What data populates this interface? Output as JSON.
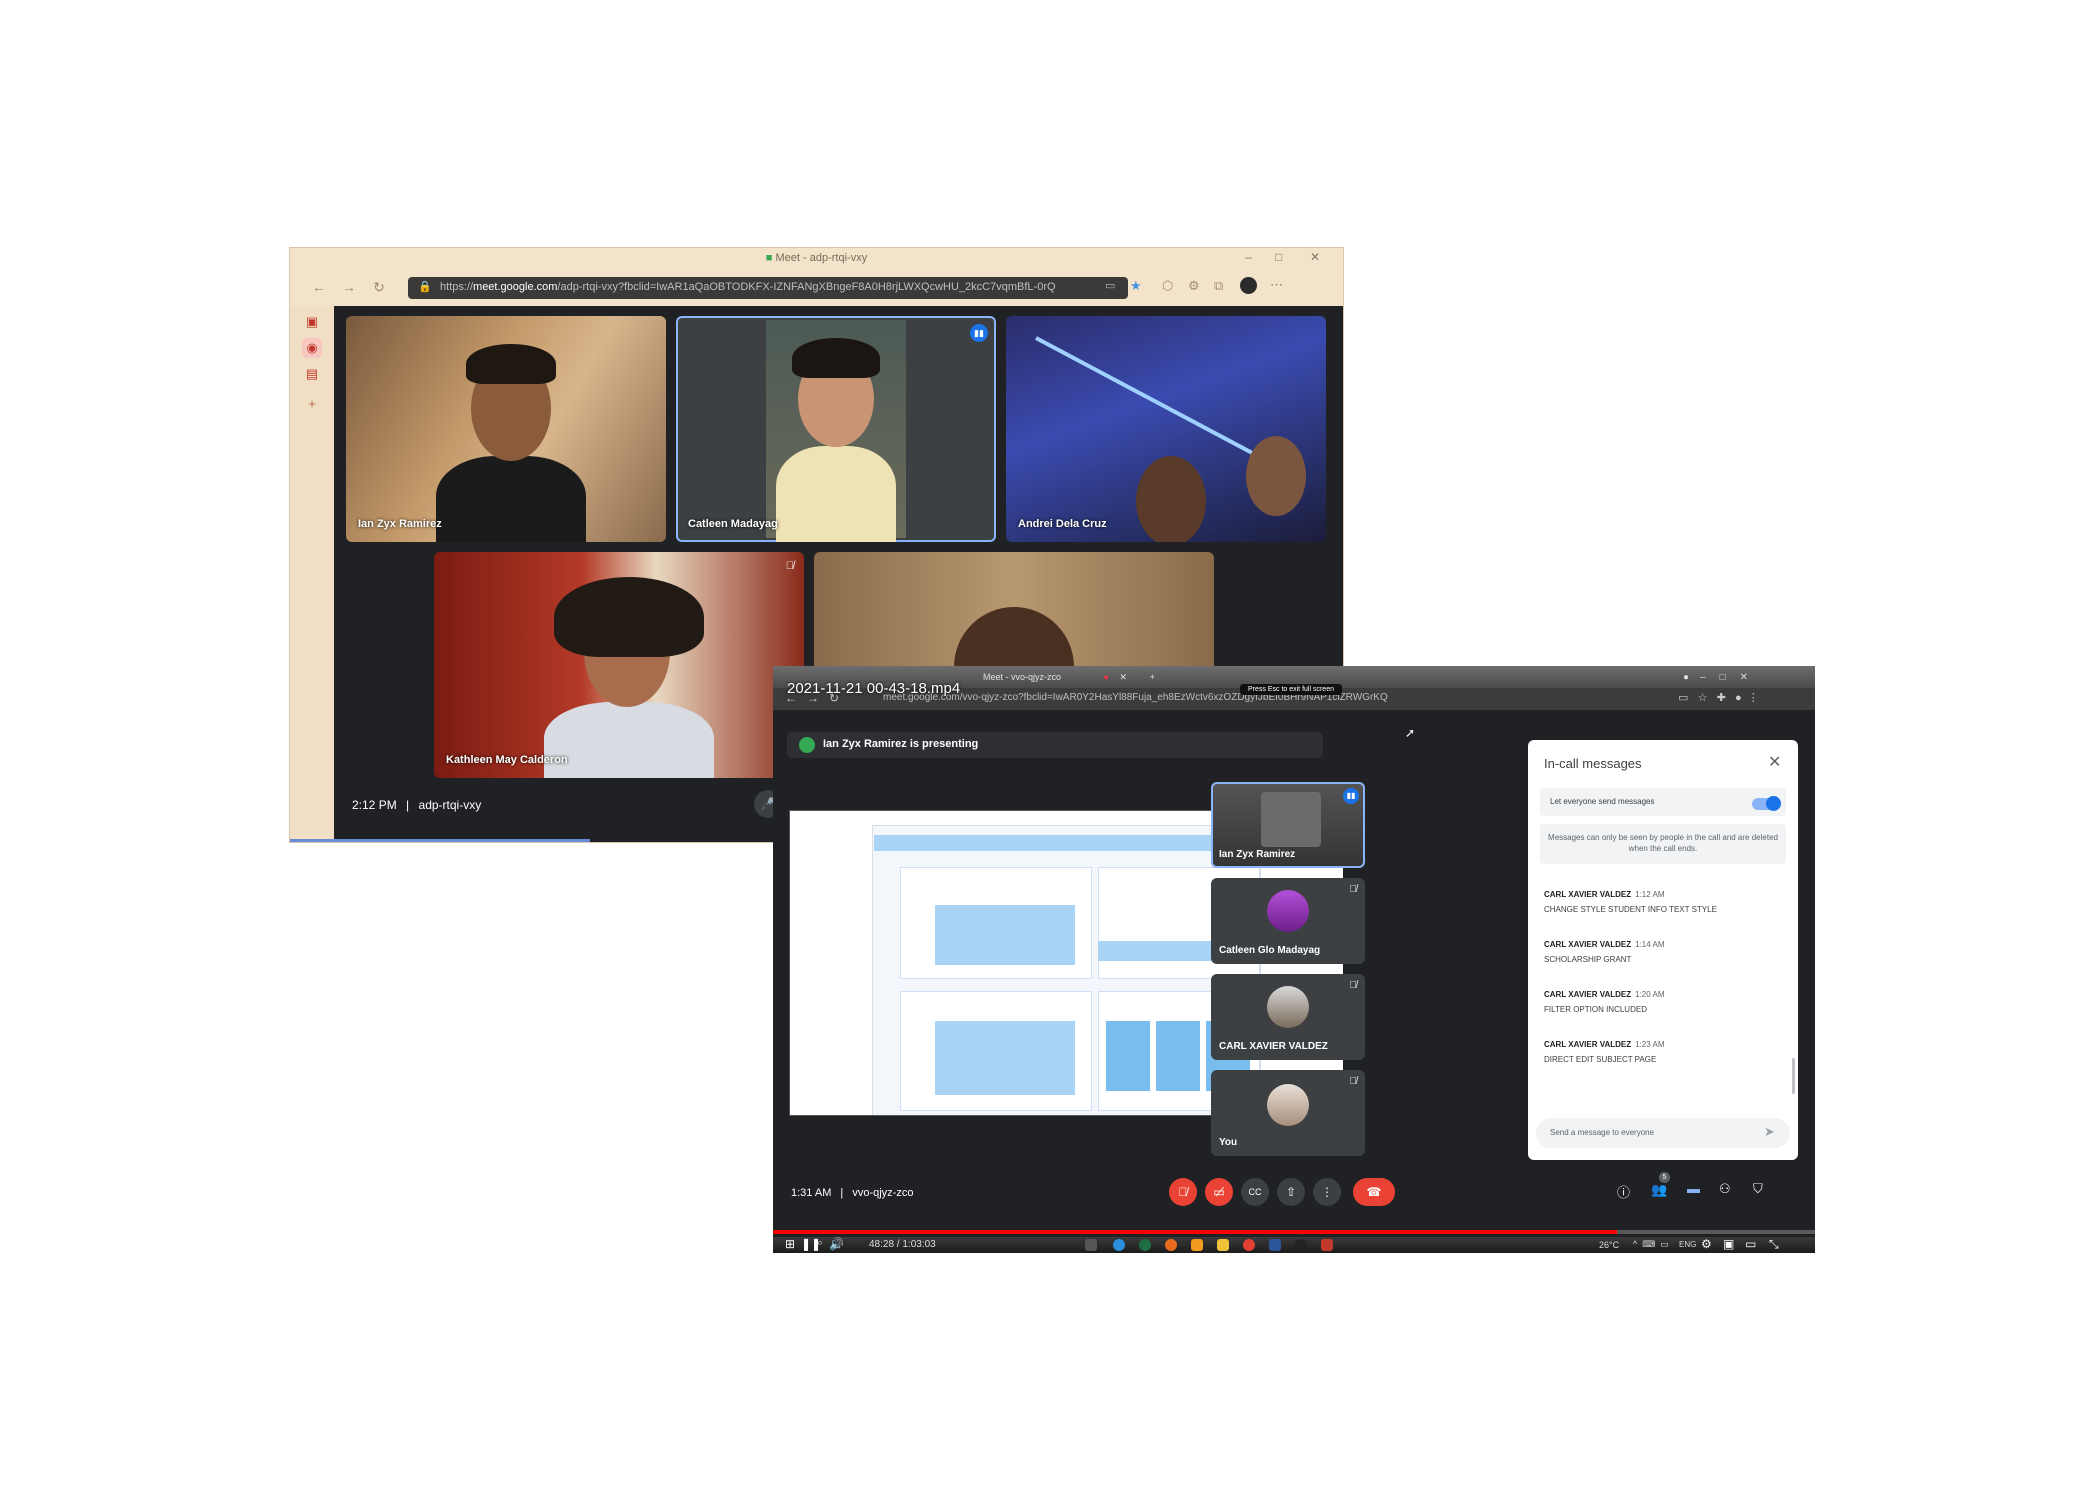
{
  "window1": {
    "tab_title": "Meet - adp-rtqi-vxy",
    "url_domain": "meet.google.com",
    "url_prefix": "https://",
    "url_path": "/adp-rtqi-vxy?fbclid=IwAR1aQaOBTODKFX-IZNFANgXBngeF8A0H8rjLWXQcwHU_2kcC7vqmBfL-0rQ",
    "participants": [
      {
        "name": "Ian Zyx Ramirez"
      },
      {
        "name": "Catleen Madayag"
      },
      {
        "name": "Andrei Dela Cruz"
      },
      {
        "name": "Kathleen May Calderon"
      },
      {
        "name": ""
      }
    ],
    "time": "2:12 PM",
    "separator": "|",
    "meeting_code": "adp-rtqi-vxy"
  },
  "window2": {
    "video_title": "2021-11-21 00-43-18.mp4",
    "tab_title": "Meet - vvo-qjyz-zco",
    "url": "meet.google.com/vvo-qjyz-zco?fbclid=IwAR0Y2HasYl88Fuja_eh8EzWctv6xzOZDgyfJbEI0BHr9NAP1clZRWGrKQ",
    "fullscreen_hint": "Press Esc to exit full screen",
    "presenting_banner": "Ian Zyx Ramirez is presenting",
    "side_tiles": [
      {
        "name": "Ian Zyx Ramirez"
      },
      {
        "name": "Catleen Glo Madayag"
      },
      {
        "name": "CARL XAVIER VALDEZ"
      },
      {
        "name": "You"
      }
    ],
    "chat": {
      "title": "In-call messages",
      "toggle_label": "Let everyone send messages",
      "note": "Messages can only be seen by people in the call and are deleted when the call ends.",
      "messages": [
        {
          "sender": "CARL XAVIER VALDEZ",
          "time": "1:12 AM",
          "text": "CHANGE STYLE STUDENT INFO TEXT STYLE"
        },
        {
          "sender": "CARL XAVIER VALDEZ",
          "time": "1:14 AM",
          "text": "SCHOLARSHIP GRANT"
        },
        {
          "sender": "CARL XAVIER VALDEZ",
          "time": "1:20 AM",
          "text": "FILTER OPTION INCLUDED"
        },
        {
          "sender": "CARL XAVIER VALDEZ",
          "time": "1:23 AM",
          "text": "DIRECT EDIT SUBJECT PAGE"
        }
      ],
      "input_placeholder": "Send a message to everyone"
    },
    "time": "1:31 AM",
    "separator": "|",
    "meeting_code": "vvo-qjyz-zco",
    "participant_count": "5",
    "player_time": "48:28 / 1:03:03",
    "weather": "26°C",
    "lang": "ENG",
    "progress_fraction": 0.81,
    "colors": {
      "meet_bg": "#202124",
      "end_call": "#ea4335",
      "accent_blue": "#8ab4f8",
      "progress_red": "#ff0000"
    }
  }
}
